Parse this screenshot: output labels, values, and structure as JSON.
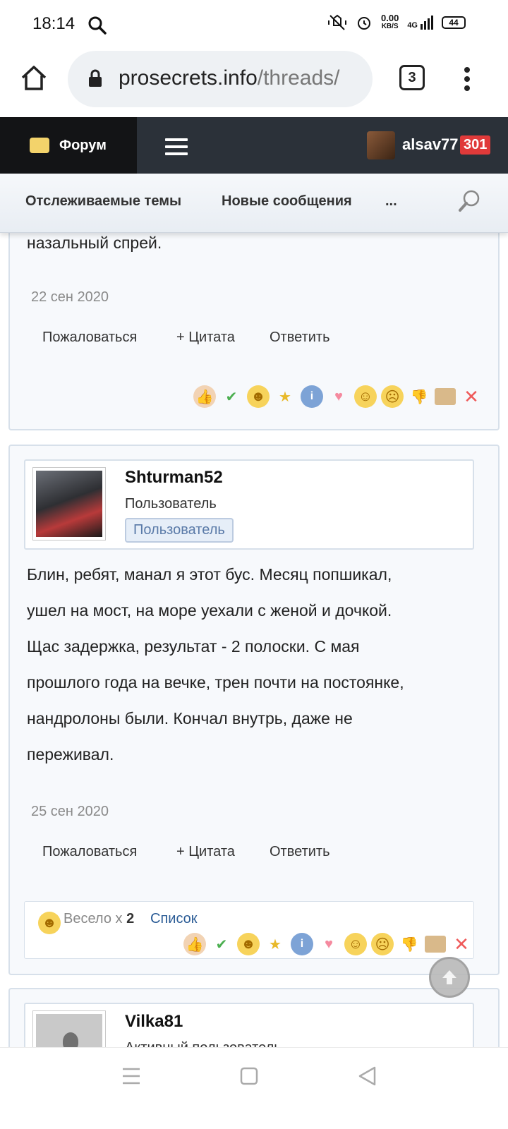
{
  "status_bar": {
    "time": "18:14",
    "speed_value": "0.00",
    "speed_unit": "KB/S",
    "network": "4G",
    "battery": "44"
  },
  "browser": {
    "url_host": "prosecrets.info",
    "url_path": "/threads/",
    "tab_count": "3"
  },
  "forum_nav": {
    "forum_label": "Форум",
    "username": "alsav77",
    "notification_count": "301"
  },
  "subnav": {
    "items": [
      "Отслеживаемые темы",
      "Новые сообщения",
      "..."
    ]
  },
  "posts": [
    {
      "text_tail": "назальный спрей.",
      "date": "22 сен 2020",
      "actions": [
        "Пожаловаться",
        "+ Цитата",
        "Ответить"
      ]
    },
    {
      "username": "Shturman52",
      "role": "Пользователь",
      "badge": "Пользователь",
      "text_lines": [
        "Блин, ребят, манал я этот бус. Месяц попшикал,",
        "ушел на мост, на море уехали с женой и дочкой.",
        "Щас задержка, результат - 2 полоски. С мая",
        "прошлого года на вечке, трен почти на постоянке,",
        "нандролоны были. Кончал внутрь, даже не",
        "переживал."
      ],
      "date": "25 сен 2020",
      "actions": [
        "Пожаловаться",
        "+ Цитата",
        "Ответить"
      ],
      "reaction_summary": {
        "label": "Весело x",
        "count": "2",
        "list_link": "Список"
      }
    },
    {
      "username": "Vilka81",
      "role": "Активный пользователь"
    }
  ],
  "reaction_icons": [
    "thumbs-up-icon",
    "check-icon",
    "laugh-icon",
    "star-medal-icon",
    "info-icon",
    "heart-icon",
    "wow-icon",
    "sad-icon",
    "thumbs-down-icon",
    "box-icon",
    "cross-icon"
  ]
}
